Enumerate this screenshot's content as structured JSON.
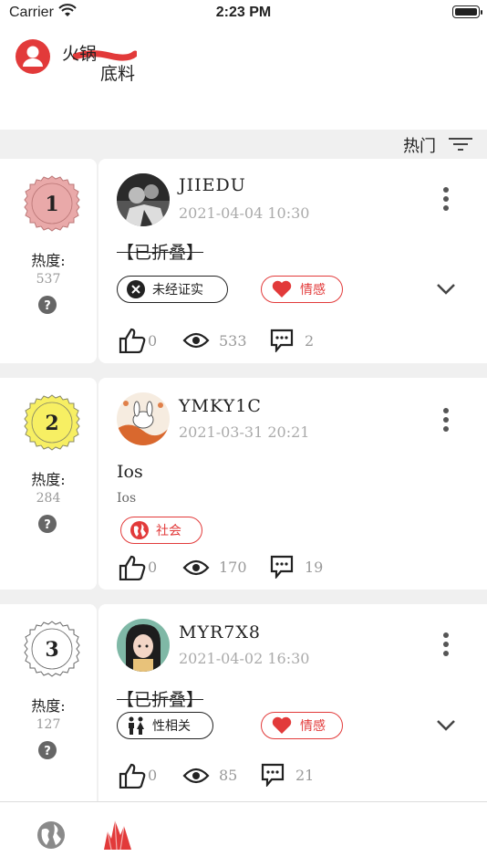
{
  "status": {
    "carrier": "Carrier",
    "time": "2:23 PM"
  },
  "header": {
    "logo_line1": "火锅",
    "logo_line2": "底料"
  },
  "sort": {
    "label": "热门"
  },
  "heat_label": "热度:",
  "posts": [
    {
      "rank": "1",
      "heat": "537",
      "username": "JIIEDU",
      "timestamp": "2021-04-04 10:30",
      "title": "【已折叠】",
      "tags": [
        "未经证实",
        "情感"
      ],
      "likes": "0",
      "views": "533",
      "comments": "2"
    },
    {
      "rank": "2",
      "heat": "284",
      "username": "YMKY1C",
      "timestamp": "2021-03-31 20:21",
      "title": "Ios",
      "body": "Ios",
      "tags": [
        "社会"
      ],
      "likes": "0",
      "views": "170",
      "comments": "19"
    },
    {
      "rank": "3",
      "heat": "127",
      "username": "MYR7X8",
      "timestamp": "2021-04-02 16:30",
      "title": "【已折叠】",
      "tags": [
        "性相关",
        "情感"
      ],
      "likes": "0",
      "views": "85",
      "comments": "21"
    }
  ],
  "colors": {
    "accent": "#e23a3a",
    "badge1": "#e9a9a9",
    "badge2": "#f7ef63",
    "badge3": "#ffffff"
  }
}
